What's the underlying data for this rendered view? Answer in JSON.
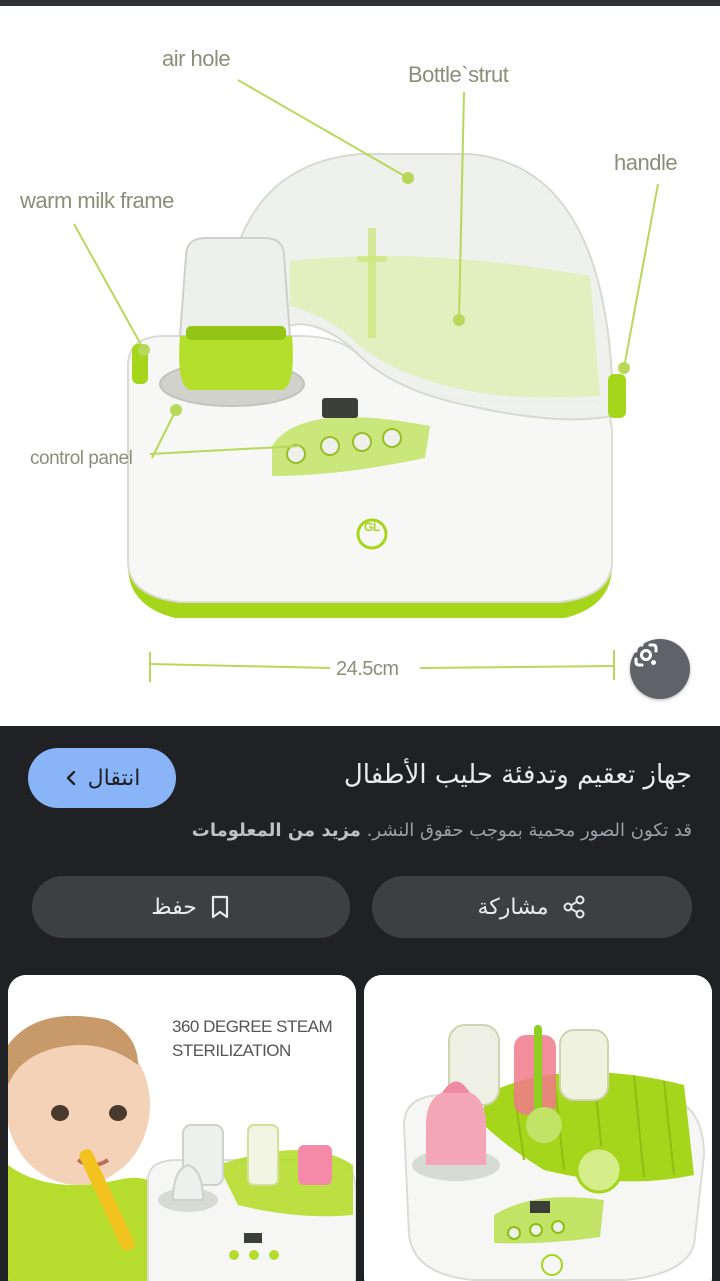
{
  "hero": {
    "callouts": {
      "air_hole": "air hole",
      "bottle_strut": "Bottle`strut",
      "handle": "handle",
      "warm_milk_frame": "warm milk frame",
      "control_panel": "control panel",
      "width": "24.5cm"
    },
    "logo_text": "GL",
    "lens_icon": "google-lens-icon"
  },
  "result": {
    "visit_label": "انتقال",
    "title": "جهاز تعقيم وتدفئة حليب الأطفال",
    "notice_text": "قد تكون الصور محمية بموجب حقوق النشر.",
    "notice_link": "مزيد من المعلومات"
  },
  "actions": {
    "share_label": "مشاركة",
    "save_label": "حفظ"
  },
  "related": {
    "left_caption_line1": "360 DEGREE STEAM",
    "left_caption_line2": "STERILIZATION"
  },
  "colors": {
    "accent_green": "#a6d61c",
    "link_blue": "#8ab4f8",
    "panel_dark": "#202124",
    "button_gray": "#3c4043"
  }
}
